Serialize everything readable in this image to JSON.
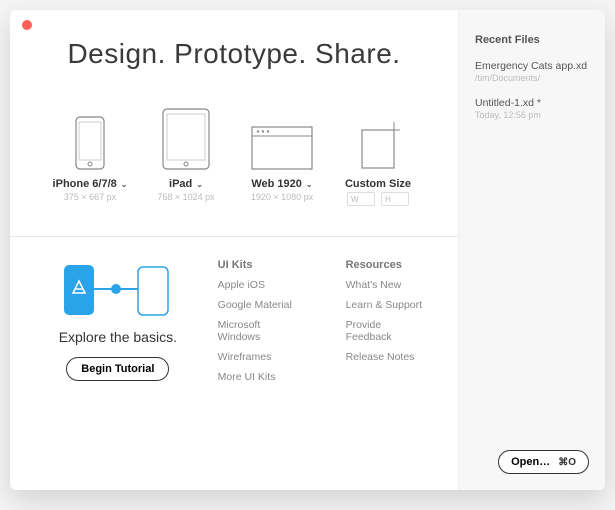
{
  "headline": "Design. Prototype. Share.",
  "presets": [
    {
      "name": "iPhone 6/7/8",
      "size": "375 × 667 px",
      "chevron": true
    },
    {
      "name": "iPad",
      "size": "768 × 1024 px",
      "chevron": true
    },
    {
      "name": "Web 1920",
      "size": "1920 × 1080 px",
      "chevron": true
    },
    {
      "name": "Custom Size",
      "w": "W",
      "h": "H",
      "chevron": false
    }
  ],
  "explore": {
    "title": "Explore the basics.",
    "button": "Begin Tutorial"
  },
  "uikits": {
    "heading": "UI Kits",
    "items": [
      "Apple iOS",
      "Google Material",
      "Microsoft Windows",
      "Wireframes",
      "More UI Kits"
    ]
  },
  "resources": {
    "heading": "Resources",
    "items": [
      "What's New",
      "Learn & Support",
      "Provide Feedback",
      "Release Notes"
    ]
  },
  "sidebar": {
    "heading": "Recent Files",
    "files": [
      {
        "name": "Emergency Cats app.xd",
        "meta": "/tim/Documents/"
      },
      {
        "name": "Untitled-1.xd *",
        "meta": "Today, 12:56 pm"
      }
    ],
    "open_label": "Open…",
    "open_shortcut": "⌘O"
  }
}
